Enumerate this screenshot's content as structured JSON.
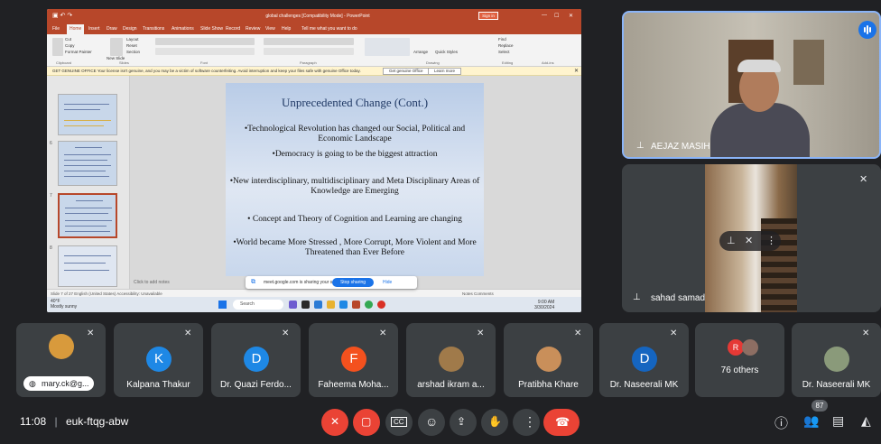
{
  "powerpoint": {
    "window_title": "global challenges [Compatibility Mode] - PowerPoint",
    "signin": "Sign in",
    "tabs": [
      "File",
      "Home",
      "Insert",
      "Draw",
      "Design",
      "Transitions",
      "Animations",
      "Slide Show",
      "Record",
      "Review",
      "View",
      "Help",
      "Tell me what you want to do"
    ],
    "active_tab": "Home",
    "ribbon_groups": [
      "Clipboard",
      "Slides",
      "Font",
      "Paragraph",
      "Drawing",
      "Editing",
      "Add-ins"
    ],
    "ribbon_labels": [
      "Cut",
      "Copy",
      "Format Painter",
      "Layout",
      "Reset",
      "Section",
      "New Slide",
      "Arrange",
      "Quick Styles",
      "Find",
      "Replace",
      "Select"
    ],
    "warning": "GET GENUINE OFFICE  Your license isn't genuine, and you may be a victim of software counterfeiting. Avoid interruption and keep your files safe with genuine Office today.",
    "warning_btn1": "Get genuine Office",
    "warning_btn2": "Learn more",
    "thumb_numbers": [
      "6",
      "7",
      "8"
    ],
    "notes_placeholder": "Click to add notes",
    "status_left": "Slide 7 of 27   English (United States)   Accessibility: Unavailable",
    "status_right": "Notes   Comments",
    "slide": {
      "title": "Unprecedented Change (Cont.)",
      "bullets": [
        "•Technological Revolution has changed our Social, Political and Economic Landscape",
        "•Democracy is going to be the biggest attraction",
        "•New interdisciplinary, multidisciplinary and Meta Disciplinary Areas of Knowledge are Emerging",
        "• Concept and Theory of Cognition and Learning are changing",
        "•World became More Stressed , More Corrupt, More Violent and More Threatened than Ever Before"
      ]
    }
  },
  "taskbar": {
    "weather_temp": "40°F",
    "weather_desc": "Mostly sunny",
    "search": "Search",
    "time": "9:00 AM",
    "date": "3/30/2024"
  },
  "share_bar": {
    "text": "meet.google.com is sharing your screen.",
    "stop": "Stop sharing",
    "hide": "Hide"
  },
  "speakers": {
    "aejaz": "AEJAZ MASIH",
    "sahad": "sahad samad"
  },
  "participants": [
    {
      "name": "mary.ck@g...",
      "initial": "",
      "color": "#d89a3c",
      "type": "photo"
    },
    {
      "name": "Kalpana Thakur",
      "initial": "K",
      "color": "#1e88e5",
      "type": "initial"
    },
    {
      "name": "Dr. Quazi Ferdo...",
      "initial": "D",
      "color": "#1e88e5",
      "type": "initial"
    },
    {
      "name": "Faheema Moha...",
      "initial": "F",
      "color": "#f4511e",
      "type": "initial"
    },
    {
      "name": "arshad ikram a...",
      "initial": "",
      "color": "#a07a4a",
      "type": "photo"
    },
    {
      "name": "Pratibha Khare",
      "initial": "",
      "color": "#c98f5a",
      "type": "photo"
    },
    {
      "name": "Dr. Naseerali MK",
      "initial": "D",
      "color": "#1565c0",
      "type": "initial"
    },
    {
      "name": "76 others",
      "initial": "R",
      "color": "#e53935",
      "type": "others"
    },
    {
      "name": "Dr. Naseerali MK",
      "initial": "",
      "color": "#8a9a7a",
      "type": "photo"
    }
  ],
  "meeting": {
    "time": "11:08",
    "code": "euk-ftqg-abw",
    "people_count": "87"
  },
  "colors": {
    "meet_bg": "#202124",
    "tile": "#3c4043",
    "red": "#ea4335",
    "accent": "#8ab4f8",
    "powerpoint": "#b7472a"
  }
}
